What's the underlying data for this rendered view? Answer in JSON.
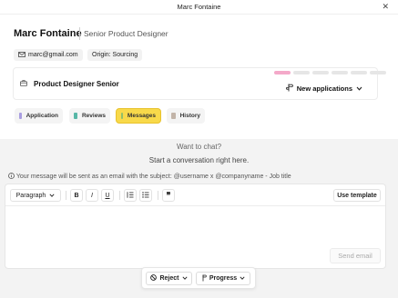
{
  "window": {
    "title": "Marc Fontaine"
  },
  "candidate": {
    "name": "Marc Fontaine",
    "role": "Senior Product Designer",
    "email": "marc@gmail.com",
    "origin": "Origin: Sourcing"
  },
  "job": {
    "title": "Product Designer Senior",
    "stage_progress": {
      "filled_steps": 1,
      "total_steps": 6
    },
    "stage_button": "New applications"
  },
  "tabs": [
    {
      "label": "Application",
      "color": "#a89de0",
      "active": false
    },
    {
      "label": "Reviews",
      "color": "#58b7a7",
      "active": false
    },
    {
      "label": "Messages",
      "color": "#8fbf6a",
      "active": true
    },
    {
      "label": "History",
      "color": "#c2b4a8",
      "active": false
    }
  ],
  "chat": {
    "empty_title": "Want to chat?",
    "empty_subtitle": "Start a conversation right here.",
    "notice": "Your message will be sent as an email with the subject: @username x @companyname - Job title"
  },
  "editor": {
    "paragraph_label": "Paragraph",
    "bold_label": "B",
    "italic_label": "I",
    "underline_label": "U",
    "template_label": "Use template",
    "send_label": "Send email"
  },
  "actions": {
    "reject_label": "Reject",
    "progress_label": "Progress"
  },
  "colors": {
    "accent_tab": "#f8d94a",
    "progress_fill": "#f4a9c9"
  }
}
